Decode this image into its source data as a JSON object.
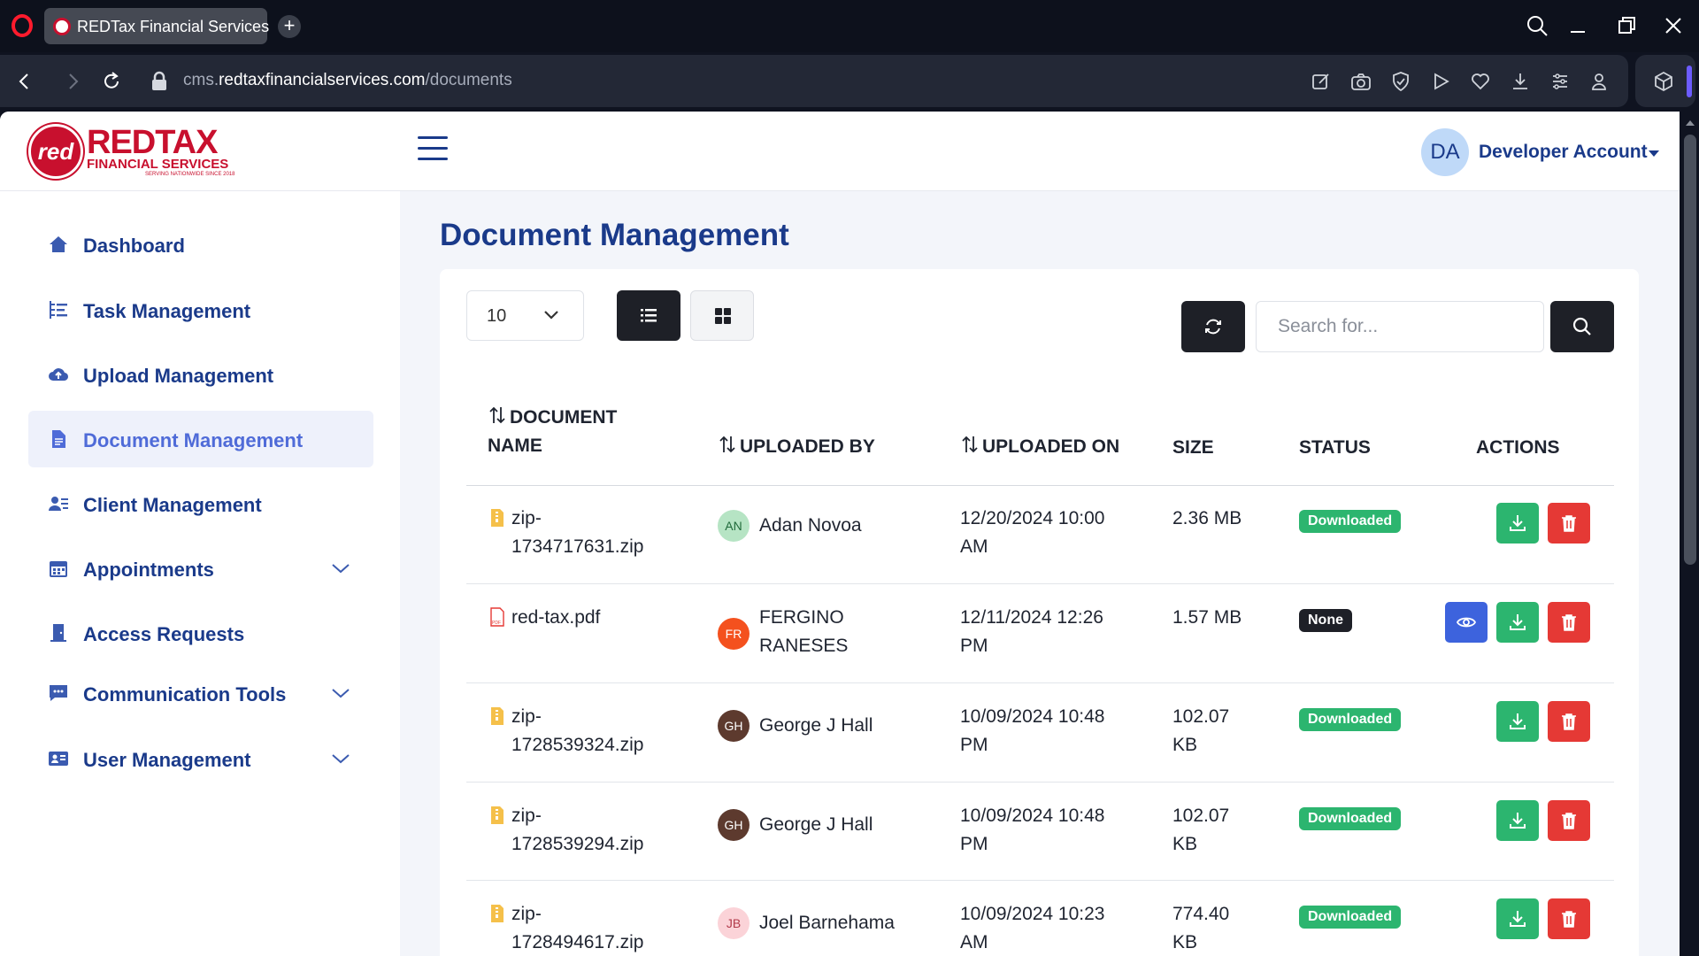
{
  "browser": {
    "tab_title": "REDTax Financial Services",
    "url_prefix": "cms.",
    "url_domain": "redtaxfinancialservices.com",
    "url_path": "/documents"
  },
  "header": {
    "logo_text": "REDTAX",
    "logo_sub": "FINANCIAL SERVICES",
    "logo_tag": "SERVING NATIONWIDE SINCE 2018",
    "logo_mark": "red",
    "user_initials": "DA",
    "user_name": "Developer Account"
  },
  "sidebar": {
    "items": [
      {
        "label": "Dashboard",
        "icon": "home-icon"
      },
      {
        "label": "Task Management",
        "icon": "tasks-icon"
      },
      {
        "label": "Upload Management",
        "icon": "cloud-upload-icon"
      },
      {
        "label": "Document Management",
        "icon": "document-icon",
        "active": true
      },
      {
        "label": "Client Management",
        "icon": "client-icon"
      },
      {
        "label": "Appointments",
        "icon": "calendar-icon",
        "expandable": true
      },
      {
        "label": "Access Requests",
        "icon": "access-icon"
      },
      {
        "label": "Communication Tools",
        "icon": "chat-icon",
        "expandable": true
      },
      {
        "label": "User Management",
        "icon": "id-card-icon",
        "expandable": true
      }
    ]
  },
  "main": {
    "title": "Document Management",
    "per_page": "10",
    "search_placeholder": "Search for...",
    "columns": {
      "name_line1": "DOCUMENT",
      "name_line2": "NAME",
      "uploaded_by": "UPLOADED BY",
      "uploaded_on": "UPLOADED ON",
      "size": "SIZE",
      "status": "STATUS",
      "actions": "ACTIONS"
    },
    "rows": [
      {
        "name_l1": "zip-",
        "name_l2": "1734717631.zip",
        "type": "zip",
        "initials": "AN",
        "user_l1": "Adan Novoa",
        "user_l2": "",
        "date_l1": "12/20/2024 10:00",
        "date_l2": "AM",
        "size_l1": "2.36 MB",
        "size_l2": "",
        "status": "Downloaded"
      },
      {
        "name_l1": "red-tax.pdf",
        "name_l2": "",
        "type": "pdf",
        "initials": "FR",
        "user_l1": "FERGINO",
        "user_l2": "RANESES",
        "date_l1": "12/11/2024 12:26",
        "date_l2": "PM",
        "size_l1": "1.57 MB",
        "size_l2": "",
        "status": "None"
      },
      {
        "name_l1": "zip-",
        "name_l2": "1728539324.zip",
        "type": "zip",
        "initials": "GH",
        "user_l1": "George J Hall",
        "user_l2": "",
        "date_l1": "10/09/2024 10:48",
        "date_l2": "PM",
        "size_l1": "102.07",
        "size_l2": "KB",
        "status": "Downloaded"
      },
      {
        "name_l1": "zip-",
        "name_l2": "1728539294.zip",
        "type": "zip",
        "initials": "GH",
        "user_l1": "George J Hall",
        "user_l2": "",
        "date_l1": "10/09/2024 10:48",
        "date_l2": "PM",
        "size_l1": "102.07",
        "size_l2": "KB",
        "status": "Downloaded"
      },
      {
        "name_l1": "zip-",
        "name_l2": "1728494617.zip",
        "type": "zip",
        "initials": "JB",
        "user_l1": "Joel Barnehama",
        "user_l2": "",
        "date_l1": "10/09/2024 10:23",
        "date_l2": "AM",
        "size_l1": "774.40",
        "size_l2": "KB",
        "status": "Downloaded"
      }
    ]
  },
  "colors": {
    "brand_red": "#c8102e",
    "navy": "#1a3a8a",
    "active_blue": "#4f6bd8",
    "success": "#2cb56f",
    "danger": "#e53935",
    "view": "#3d63dd"
  }
}
